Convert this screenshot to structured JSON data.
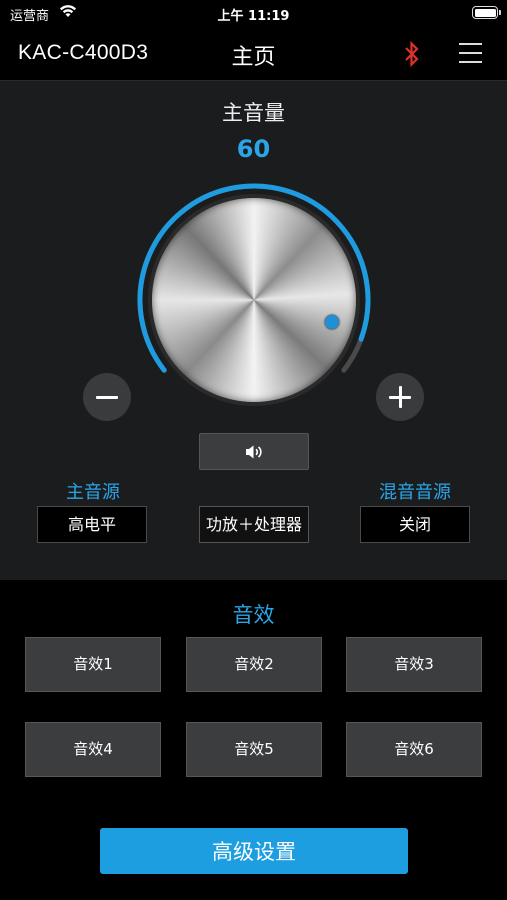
{
  "status_bar": {
    "carrier": "运营商",
    "time": "上午 11:19",
    "wifi_icon": "wifi-icon",
    "battery_icon": "battery-icon"
  },
  "nav": {
    "device": "KAC-C400D3",
    "title": "主页",
    "bluetooth_icon": "bluetooth-icon",
    "bluetooth_color": "#e0302a",
    "menu_icon": "menu-icon"
  },
  "volume": {
    "label": "主音量",
    "value": "60",
    "accent": "#2aa6e8",
    "level_fraction": 0.6
  },
  "controls": {
    "minus_icon": "minus-icon",
    "plus_icon": "plus-icon",
    "speaker_icon": "speaker-icon"
  },
  "sources": {
    "main_label": "主音源",
    "main_value": "高电平",
    "amp_value": "功放＋处理器",
    "mix_label": "混音音源",
    "mix_value": "关闭"
  },
  "effects": {
    "title": "音效",
    "items": [
      "音效1",
      "音效2",
      "音效3",
      "音效4",
      "音效5",
      "音效6"
    ]
  },
  "advanced": {
    "label": "高级设置",
    "color": "#1c9ee0"
  }
}
